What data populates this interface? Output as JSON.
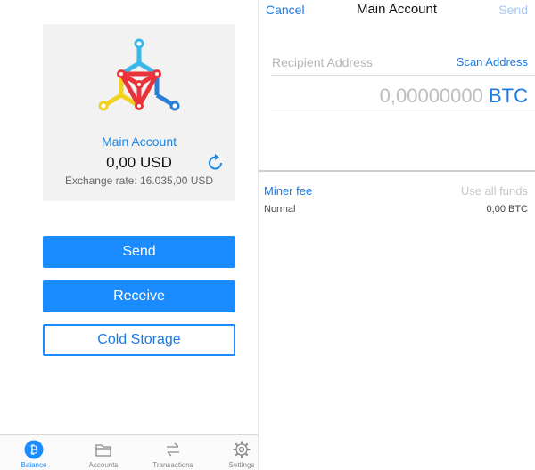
{
  "balance_screen": {
    "account_name": "Main Account",
    "balance": "0,00 USD",
    "exchange_rate": "Exchange rate: 16.035,00 USD",
    "buttons": {
      "send": "Send",
      "receive": "Receive",
      "cold_storage": "Cold Storage"
    },
    "tabs": [
      {
        "label": "Balance",
        "icon": "bitcoin-icon",
        "active": true
      },
      {
        "label": "Accounts",
        "icon": "folder-icon",
        "active": false
      },
      {
        "label": "Transactions",
        "icon": "swap-arrows-icon",
        "active": false
      },
      {
        "label": "Settings",
        "icon": "gear-icon",
        "active": false
      }
    ]
  },
  "send_screen": {
    "nav": {
      "cancel": "Cancel",
      "title": "Main Account",
      "send": "Send"
    },
    "recipient_placeholder": "Recipient Address",
    "scan_address": "Scan Address",
    "amount": "0,00000000",
    "currency": "BTC",
    "miner_fee_label": "Miner fee",
    "use_all_funds": "Use all funds",
    "fee_level": "Normal",
    "fee_amount": "0,00 BTC"
  },
  "colors": {
    "accent": "#1a8cff",
    "link": "#1a7ae6",
    "disabled": "#a8c6ee"
  }
}
